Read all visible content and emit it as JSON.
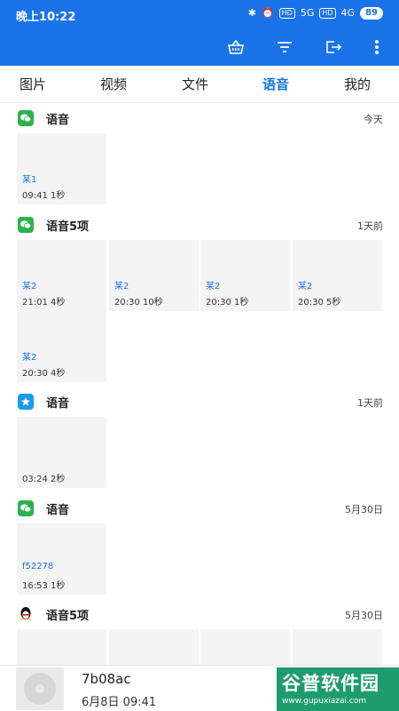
{
  "status": {
    "time": "晚上10:22",
    "hd1": "HD",
    "sig1": "5G",
    "hd2": "HD",
    "sig2": "4G",
    "battery": "89"
  },
  "toolbar": {
    "icons": [
      "basket-icon",
      "filter-icon",
      "exit-icon",
      "more-vert-icon"
    ]
  },
  "tabs": [
    {
      "label": "图片",
      "active": false
    },
    {
      "label": "视频",
      "active": false
    },
    {
      "label": "文件",
      "active": false
    },
    {
      "label": "语音",
      "active": true
    },
    {
      "label": "我的",
      "active": false
    }
  ],
  "groups": [
    {
      "title": "语音",
      "date": "今天",
      "app": "wechat",
      "items": [
        {
          "name": "某1",
          "meta": "09:41  1秒"
        }
      ]
    },
    {
      "title": "语音5项",
      "date": "1天前",
      "app": "wechat",
      "items": [
        {
          "name": "某2",
          "meta": "21:01  4秒"
        },
        {
          "name": "某2",
          "meta": "20:30  10秒"
        },
        {
          "name": "某2",
          "meta": "20:30  1秒"
        },
        {
          "name": "某2",
          "meta": "20:30  5秒"
        },
        {
          "name": "某2",
          "meta": "20:30  4秒"
        }
      ]
    },
    {
      "title": "语音",
      "date": "1天前",
      "app": "star-app",
      "items": [
        {
          "name": "",
          "meta": "03:24  2秒"
        }
      ]
    },
    {
      "title": "语音",
      "date": "5月30日",
      "app": "wechat",
      "items": [
        {
          "name": "f52278",
          "meta": "16:53  1秒"
        }
      ]
    },
    {
      "title": "语音5项",
      "date": "5月30日",
      "app": "qq",
      "items": [
        {
          "name": "",
          "meta": ""
        },
        {
          "name": "",
          "meta": ""
        },
        {
          "name": "",
          "meta": ""
        },
        {
          "name": "",
          "meta": ""
        }
      ]
    }
  ],
  "player": {
    "title": "7b08ac",
    "date": "6月8日  09:41"
  },
  "watermark": {
    "title": "谷普软件园",
    "url": "www.gupuxiazai.com"
  },
  "colors": {
    "primary": "#1a73e8",
    "wechat": "#2bb24c",
    "starApp": "#1a9af0"
  }
}
